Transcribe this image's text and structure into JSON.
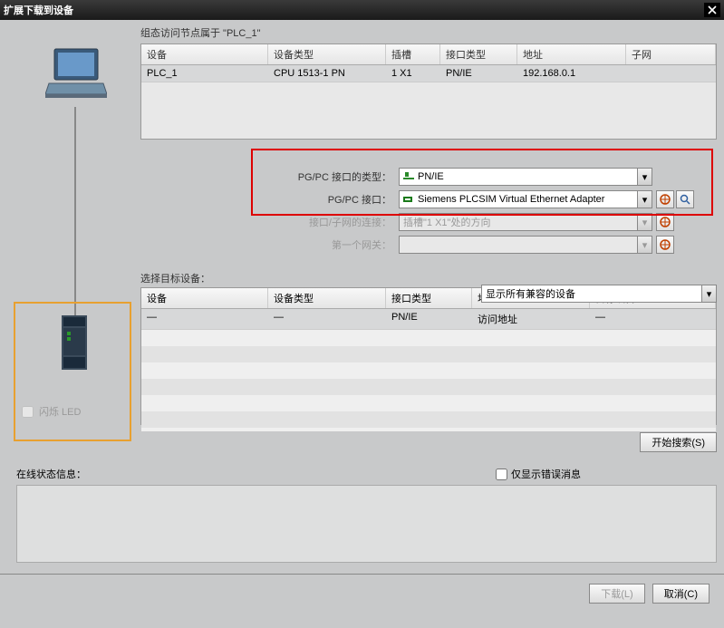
{
  "window": {
    "title": "扩展下载到设备"
  },
  "node_section": {
    "label": "组态访问节点属于 \"PLC_1\""
  },
  "table1": {
    "headers": {
      "device": "设备",
      "type": "设备类型",
      "slot": "插槽",
      "iftype": "接口类型",
      "addr": "地址",
      "subnet": "子网"
    },
    "rows": [
      {
        "device": "PLC_1",
        "type": "CPU 1513-1 PN",
        "slot": "1 X1",
        "iftype": "PN/IE",
        "addr": "192.168.0.1",
        "subnet": ""
      }
    ]
  },
  "config": {
    "iftype_label": "PG/PC 接口的类型：",
    "iftype_value": "PN/IE",
    "if_label": "PG/PC 接口：",
    "if_value": "Siemens PLCSIM Virtual Ethernet Adapter",
    "conn_label": "接口/子网的连接：",
    "conn_value": "插槽\"1 X1\"处的方向",
    "gateway_label": "第一个网关：",
    "gateway_value": ""
  },
  "led": {
    "label": "闪烁 LED"
  },
  "target": {
    "label": "选择目标设备：",
    "filter": "显示所有兼容的设备",
    "headers": {
      "device": "设备",
      "type": "设备类型",
      "iftype": "接口类型",
      "addr": "地址",
      "tgt": "目标设备"
    },
    "rows": [
      {
        "device": "—",
        "type": "—",
        "iftype": "PN/IE",
        "addr": "访问地址",
        "tgt": "—"
      }
    ]
  },
  "buttons": {
    "search": "开始搜索(S)",
    "download": "下载(L)",
    "cancel": "取消(C)"
  },
  "status": {
    "label": "在线状态信息：",
    "only_errors": "仅显示错误消息"
  }
}
